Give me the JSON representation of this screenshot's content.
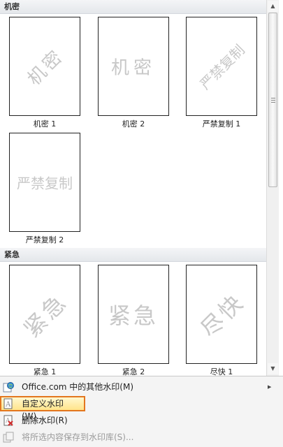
{
  "sections": [
    {
      "title": "机密"
    },
    {
      "title": "紧急"
    }
  ],
  "tiles": [
    {
      "caption": "机密 1",
      "watermark": "机密"
    },
    {
      "caption": "机密 2",
      "watermark": "机密"
    },
    {
      "caption": "严禁复制 1",
      "watermark": "严禁复制"
    },
    {
      "caption": "严禁复制 2",
      "watermark": "严禁复制"
    },
    {
      "caption": "紧急 1",
      "watermark": "紧急"
    },
    {
      "caption": "紧急 2",
      "watermark": "紧急"
    },
    {
      "caption": "尽快 1",
      "watermark": "尽快"
    }
  ],
  "menu": {
    "items": [
      {
        "label": "Office.com 中的其他水印(M)",
        "icon": "globe-icon",
        "has_submenu": true
      },
      {
        "label": "自定义水印(W)...",
        "icon": "watermark-icon",
        "highlighted": true
      },
      {
        "label": "删除水印(R)",
        "icon": "delete-watermark-icon"
      },
      {
        "label": "将所选内容保存到水印库(S)...",
        "icon": "save-to-gallery-icon",
        "disabled": true
      }
    ]
  },
  "colors": {
    "highlight_border": "#e3761e",
    "watermark_text": "#c8c8c8"
  }
}
